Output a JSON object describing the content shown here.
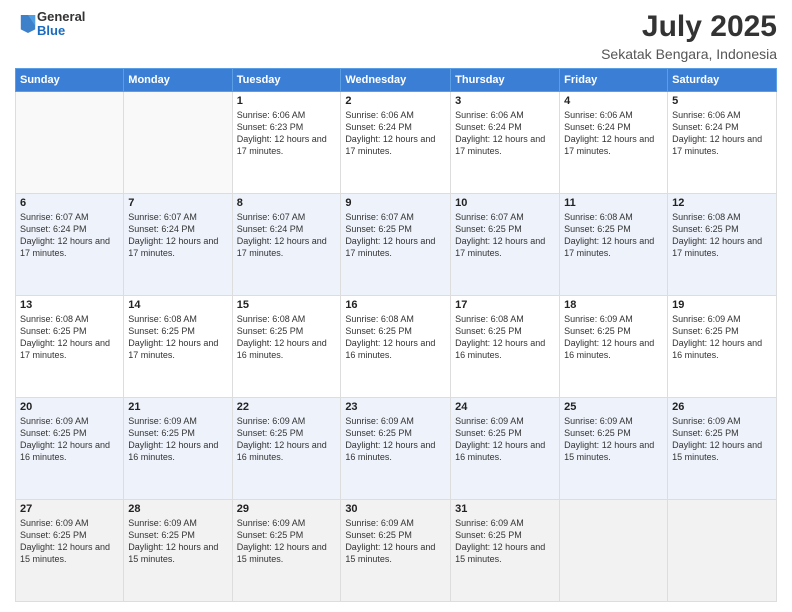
{
  "logo": {
    "line1": "General",
    "line2": "Blue"
  },
  "title": "July 2025",
  "subtitle": "Sekatak Bengara, Indonesia",
  "weekdays": [
    "Sunday",
    "Monday",
    "Tuesday",
    "Wednesday",
    "Thursday",
    "Friday",
    "Saturday"
  ],
  "weeks": [
    [
      {
        "day": "",
        "info": ""
      },
      {
        "day": "",
        "info": ""
      },
      {
        "day": "1",
        "info": "Sunrise: 6:06 AM\nSunset: 6:23 PM\nDaylight: 12 hours and 17 minutes."
      },
      {
        "day": "2",
        "info": "Sunrise: 6:06 AM\nSunset: 6:24 PM\nDaylight: 12 hours and 17 minutes."
      },
      {
        "day": "3",
        "info": "Sunrise: 6:06 AM\nSunset: 6:24 PM\nDaylight: 12 hours and 17 minutes."
      },
      {
        "day": "4",
        "info": "Sunrise: 6:06 AM\nSunset: 6:24 PM\nDaylight: 12 hours and 17 minutes."
      },
      {
        "day": "5",
        "info": "Sunrise: 6:06 AM\nSunset: 6:24 PM\nDaylight: 12 hours and 17 minutes."
      }
    ],
    [
      {
        "day": "6",
        "info": "Sunrise: 6:07 AM\nSunset: 6:24 PM\nDaylight: 12 hours and 17 minutes."
      },
      {
        "day": "7",
        "info": "Sunrise: 6:07 AM\nSunset: 6:24 PM\nDaylight: 12 hours and 17 minutes."
      },
      {
        "day": "8",
        "info": "Sunrise: 6:07 AM\nSunset: 6:24 PM\nDaylight: 12 hours and 17 minutes."
      },
      {
        "day": "9",
        "info": "Sunrise: 6:07 AM\nSunset: 6:25 PM\nDaylight: 12 hours and 17 minutes."
      },
      {
        "day": "10",
        "info": "Sunrise: 6:07 AM\nSunset: 6:25 PM\nDaylight: 12 hours and 17 minutes."
      },
      {
        "day": "11",
        "info": "Sunrise: 6:08 AM\nSunset: 6:25 PM\nDaylight: 12 hours and 17 minutes."
      },
      {
        "day": "12",
        "info": "Sunrise: 6:08 AM\nSunset: 6:25 PM\nDaylight: 12 hours and 17 minutes."
      }
    ],
    [
      {
        "day": "13",
        "info": "Sunrise: 6:08 AM\nSunset: 6:25 PM\nDaylight: 12 hours and 17 minutes."
      },
      {
        "day": "14",
        "info": "Sunrise: 6:08 AM\nSunset: 6:25 PM\nDaylight: 12 hours and 17 minutes."
      },
      {
        "day": "15",
        "info": "Sunrise: 6:08 AM\nSunset: 6:25 PM\nDaylight: 12 hours and 16 minutes."
      },
      {
        "day": "16",
        "info": "Sunrise: 6:08 AM\nSunset: 6:25 PM\nDaylight: 12 hours and 16 minutes."
      },
      {
        "day": "17",
        "info": "Sunrise: 6:08 AM\nSunset: 6:25 PM\nDaylight: 12 hours and 16 minutes."
      },
      {
        "day": "18",
        "info": "Sunrise: 6:09 AM\nSunset: 6:25 PM\nDaylight: 12 hours and 16 minutes."
      },
      {
        "day": "19",
        "info": "Sunrise: 6:09 AM\nSunset: 6:25 PM\nDaylight: 12 hours and 16 minutes."
      }
    ],
    [
      {
        "day": "20",
        "info": "Sunrise: 6:09 AM\nSunset: 6:25 PM\nDaylight: 12 hours and 16 minutes."
      },
      {
        "day": "21",
        "info": "Sunrise: 6:09 AM\nSunset: 6:25 PM\nDaylight: 12 hours and 16 minutes."
      },
      {
        "day": "22",
        "info": "Sunrise: 6:09 AM\nSunset: 6:25 PM\nDaylight: 12 hours and 16 minutes."
      },
      {
        "day": "23",
        "info": "Sunrise: 6:09 AM\nSunset: 6:25 PM\nDaylight: 12 hours and 16 minutes."
      },
      {
        "day": "24",
        "info": "Sunrise: 6:09 AM\nSunset: 6:25 PM\nDaylight: 12 hours and 16 minutes."
      },
      {
        "day": "25",
        "info": "Sunrise: 6:09 AM\nSunset: 6:25 PM\nDaylight: 12 hours and 15 minutes."
      },
      {
        "day": "26",
        "info": "Sunrise: 6:09 AM\nSunset: 6:25 PM\nDaylight: 12 hours and 15 minutes."
      }
    ],
    [
      {
        "day": "27",
        "info": "Sunrise: 6:09 AM\nSunset: 6:25 PM\nDaylight: 12 hours and 15 minutes."
      },
      {
        "day": "28",
        "info": "Sunrise: 6:09 AM\nSunset: 6:25 PM\nDaylight: 12 hours and 15 minutes."
      },
      {
        "day": "29",
        "info": "Sunrise: 6:09 AM\nSunset: 6:25 PM\nDaylight: 12 hours and 15 minutes."
      },
      {
        "day": "30",
        "info": "Sunrise: 6:09 AM\nSunset: 6:25 PM\nDaylight: 12 hours and 15 minutes."
      },
      {
        "day": "31",
        "info": "Sunrise: 6:09 AM\nSunset: 6:25 PM\nDaylight: 12 hours and 15 minutes."
      },
      {
        "day": "",
        "info": ""
      },
      {
        "day": "",
        "info": ""
      }
    ]
  ]
}
